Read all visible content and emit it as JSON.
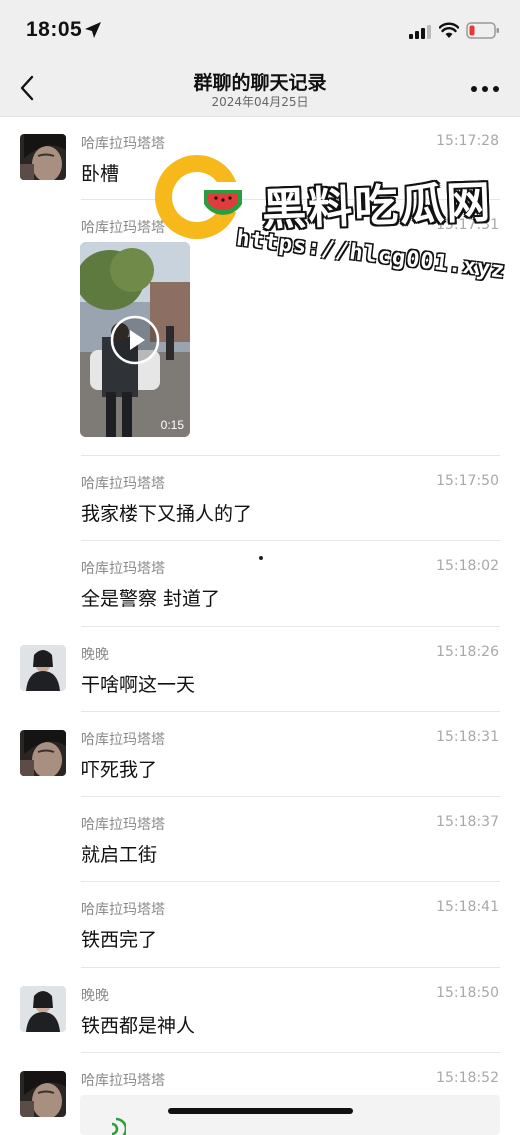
{
  "status_bar": {
    "time": "18:05"
  },
  "nav": {
    "title": "群聊的聊天记录",
    "subtitle": "2024年04月25日"
  },
  "watermark": {
    "title": "黑料吃瓜网",
    "url": "https://hlcg001.xyz"
  },
  "messages": [
    {
      "sender": "哈库拉玛塔塔",
      "time": "15:17:28",
      "text": "卧槽",
      "avatar": "avatar-a"
    },
    {
      "sender": "哈库拉玛塔塔",
      "time": "15:17:31",
      "type": "video",
      "duration": "0:15"
    },
    {
      "sender": "哈库拉玛塔塔",
      "time": "15:17:50",
      "text": "我家楼下又捅人的了"
    },
    {
      "sender": "哈库拉玛塔塔",
      "time": "15:18:02",
      "text": "全是警察 封道了"
    },
    {
      "sender": "晚晚",
      "time": "15:18:26",
      "text": "干啥啊这一天",
      "avatar": "avatar-b"
    },
    {
      "sender": "哈库拉玛塔塔",
      "time": "15:18:31",
      "text": "吓死我了",
      "avatar": "avatar-a"
    },
    {
      "sender": "哈库拉玛塔塔",
      "time": "15:18:37",
      "text": "就启工街"
    },
    {
      "sender": "哈库拉玛塔塔",
      "time": "15:18:41",
      "text": "铁西完了"
    },
    {
      "sender": "晚晚",
      "time": "15:18:50",
      "text": "铁西都是神人",
      "avatar": "avatar-b"
    },
    {
      "sender": "哈库拉玛塔塔",
      "time": "15:18:52",
      "type": "voice",
      "avatar": "avatar-a"
    }
  ],
  "colors": {
    "header_bg": "#efefef",
    "divider": "#e6e6e6",
    "secondary_text": "#8a8a8a",
    "logo_yellow": "#f6b81a",
    "logo_green": "#2a9d3e",
    "logo_red": "#e23b3b"
  },
  "icons": [
    "location-arrow-icon",
    "signal-icon",
    "wifi-icon",
    "battery-icon",
    "back-chevron-icon",
    "more-icon",
    "play-icon",
    "voice-icon"
  ]
}
